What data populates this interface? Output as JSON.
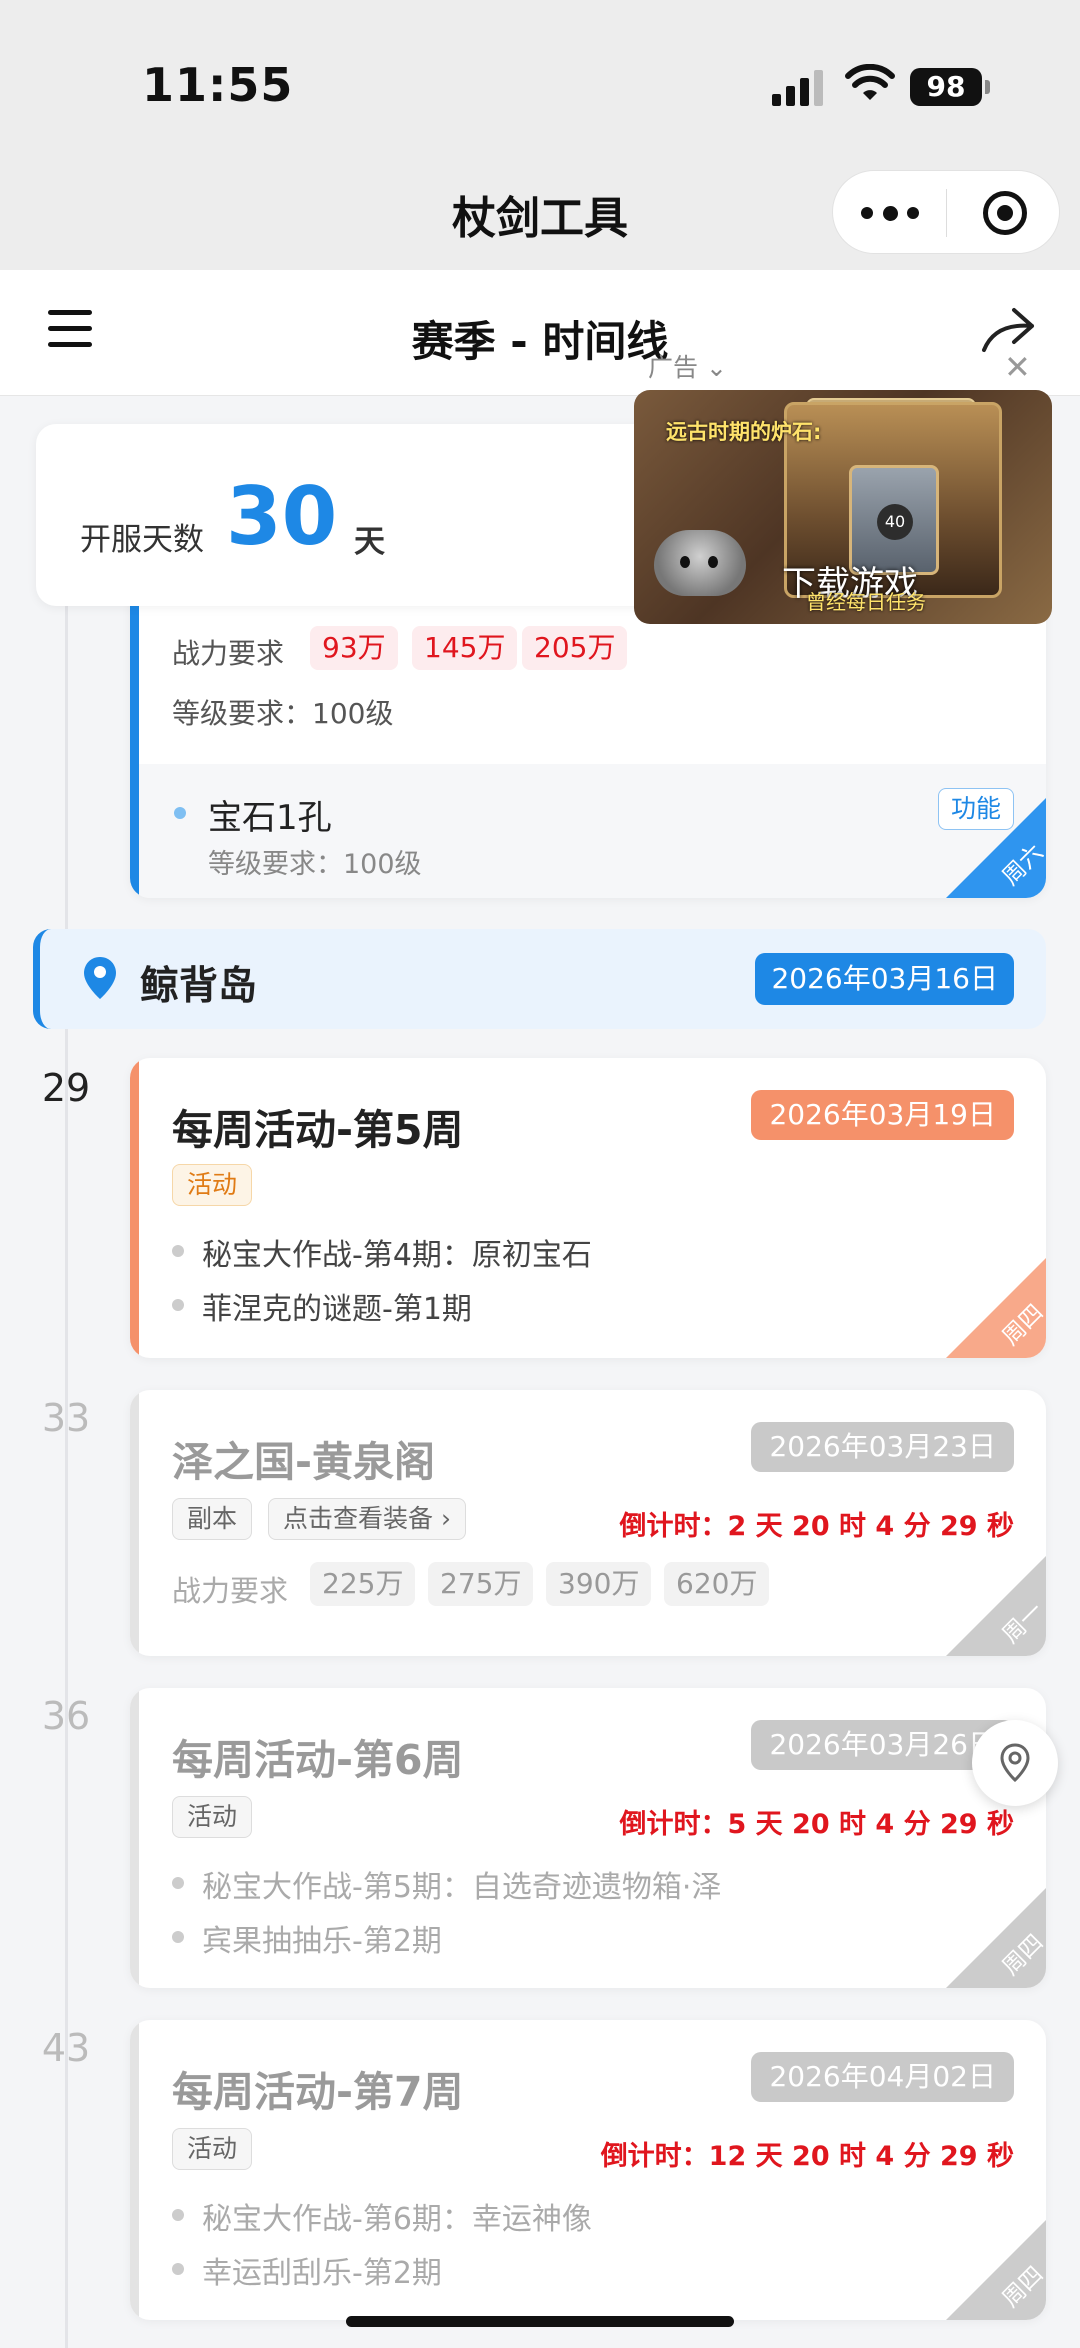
{
  "status_bar": {
    "time": "11:55",
    "battery": "98"
  },
  "wechat_bar": {
    "title": "杖剑工具"
  },
  "page_header": {
    "title": "赛季 - 时间线"
  },
  "summary": {
    "label": "开服天数",
    "value": "30",
    "unit": "天"
  },
  "ad": {
    "label": "广告",
    "close": "✕",
    "headline": "远古时期的炉石:",
    "cta": "下载游戏",
    "subcta": "曾经每日任务",
    "coin": "40"
  },
  "card_a": {
    "power_label": "战力要求",
    "power_values": [
      "93万",
      "145万",
      "205万"
    ],
    "level_label": "等级要求：100级",
    "sub_title": "宝石1孔",
    "sub_level": "等级要求：100级",
    "func_tag": "功能",
    "corner": "周六"
  },
  "location": {
    "name": "鲸背岛",
    "date": "2026年03月16日"
  },
  "events": [
    {
      "day": "29",
      "title": "每周活动-第5周",
      "date": "2026年03月19日",
      "tag": "活动",
      "items": [
        "秘宝大作战-第4期：原初宝石",
        "菲涅克的谜题-第1期"
      ],
      "corner": "周四",
      "color": "#f5916a"
    },
    {
      "day": "33",
      "title": "泽之国-黄泉阁",
      "date": "2026年03月23日",
      "tag": "副本",
      "link": "点击查看装备",
      "countdown": "倒计时：2 天 20 时 4 分 29 秒",
      "power_label": "战力要求",
      "power_values": [
        "225万",
        "275万",
        "390万",
        "620万"
      ],
      "corner": "周一"
    },
    {
      "day": "36",
      "title": "每周活动-第6周",
      "date": "2026年03月26日",
      "tag": "活动",
      "countdown": "倒计时：5 天 20 时 4 分 29 秒",
      "items": [
        "秘宝大作战-第5期：自选奇迹遗物箱·泽",
        "宾果抽抽乐-第2期"
      ],
      "corner": "周四"
    },
    {
      "day": "43",
      "title": "每周活动-第7周",
      "date": "2026年04月02日",
      "tag": "活动",
      "countdown": "倒计时：12 天 20 时 4 分 29 秒",
      "items": [
        "秘宝大作战-第6期：幸运神像",
        "幸运刮刮乐-第2期"
      ],
      "corner": "周四"
    }
  ],
  "colors": {
    "accent_blue": "#1e88e5",
    "accent_orange": "#f5916a",
    "countdown_red": "#e0161e",
    "inactive_gray": "#c9c9c9"
  }
}
